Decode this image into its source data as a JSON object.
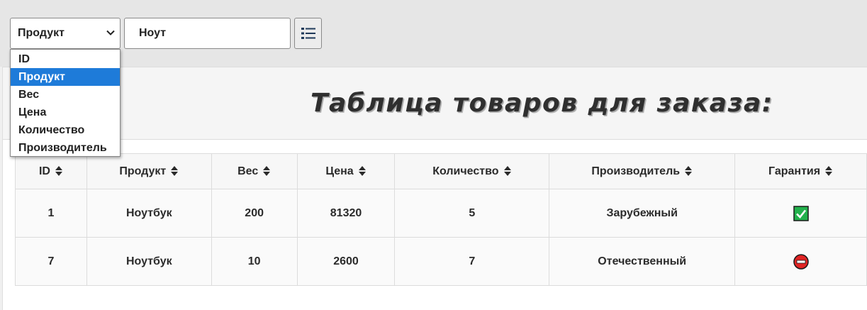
{
  "toolbar": {
    "filter_field_selected": "Продукт",
    "search_value": "Ноут",
    "filter_options": [
      "ID",
      "Продукт",
      "Вес",
      "Цена",
      "Количество",
      "Производитель"
    ],
    "active_option_index": 1,
    "list_button_icon": "list-icon"
  },
  "panel": {
    "title": "Таблица товаров для заказа:"
  },
  "table": {
    "columns": [
      "ID",
      "Продукт",
      "Вес",
      "Цена",
      "Количество",
      "Производитель",
      "Гарантия"
    ],
    "rows": [
      {
        "id": "1",
        "product": "Ноутбук",
        "weight": "200",
        "price": "81320",
        "quantity": "5",
        "manufacturer": "Зарубежный",
        "warranty": "check-icon"
      },
      {
        "id": "7",
        "product": "Ноутбук",
        "weight": "10",
        "price": "2600",
        "quantity": "7",
        "manufacturer": "Отечественный",
        "warranty": "no-entry-icon"
      }
    ]
  },
  "colors": {
    "active_option_bg": "#1e7bd9",
    "warranty_yes": "#22b14c",
    "warranty_no": "#e02424"
  }
}
